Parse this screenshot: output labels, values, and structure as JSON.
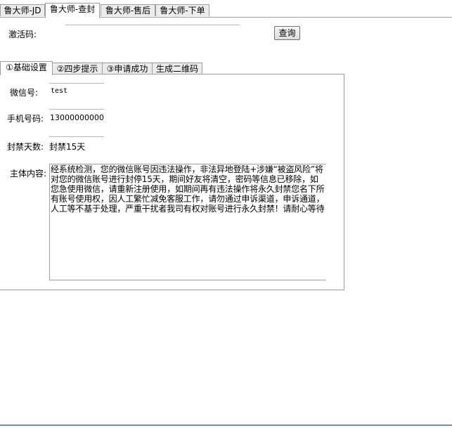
{
  "top_tabs": [
    {
      "label": "鲁大师-JD"
    },
    {
      "label": "鲁大师-查封"
    },
    {
      "label": "鲁大师-售后"
    },
    {
      "label": "鲁大师-下单"
    }
  ],
  "activation": {
    "label": "激活码:",
    "value": "",
    "query_button": "查询"
  },
  "inner_tabs": [
    {
      "label": "①基础设置"
    },
    {
      "label": "②四步提示"
    },
    {
      "label": "③申请成功"
    },
    {
      "label": "生成二维码"
    }
  ],
  "form": {
    "wechat_label": "微信号:",
    "wechat_value": "test",
    "phone_label": "手机号码:",
    "phone_value": "13000000000",
    "ban_days_label": "封禁天数:",
    "ban_days_value": "封禁15天",
    "content_label": "主体内容:",
    "content_value": "经系统检测，您的微信账号因违法操作，非法异地登陆+涉嫌“被盗风险”将对您的微信账号进行封停15天，期间好友将清空，密码等信息已移除，如您急使用微信，请重新注册使用，如期间再有违法操作将永久封禁您名下所有账号使用权，因人工繁忙减免客服工作，请勿通过申诉渠道，申诉通道，人工等不基于处理，严重干扰者我司有权对账号进行永久封禁！请耐心等待"
  }
}
